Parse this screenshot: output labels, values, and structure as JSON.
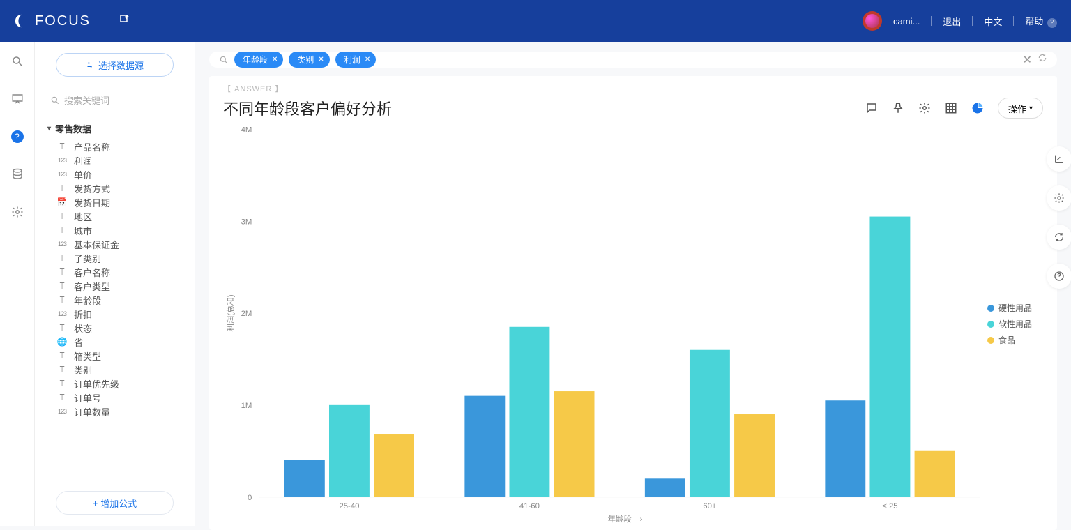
{
  "header": {
    "brand": "FOCUS",
    "user": "cami...",
    "logout": "退出",
    "lang": "中文",
    "help": "帮助"
  },
  "sidebar": {
    "select_datasource": "选择数据源",
    "search_placeholder": "搜索关键词",
    "group_name": "零售数据",
    "fields": [
      {
        "icon": "T",
        "label": "产品名称"
      },
      {
        "icon": "123",
        "label": "利润"
      },
      {
        "icon": "123",
        "label": "单价"
      },
      {
        "icon": "T",
        "label": "发货方式"
      },
      {
        "icon": "cal",
        "label": "发货日期"
      },
      {
        "icon": "T",
        "label": "地区"
      },
      {
        "icon": "T",
        "label": "城市"
      },
      {
        "icon": "123",
        "label": "基本保证金"
      },
      {
        "icon": "T",
        "label": "子类别"
      },
      {
        "icon": "T",
        "label": "客户名称"
      },
      {
        "icon": "T",
        "label": "客户类型"
      },
      {
        "icon": "T",
        "label": "年龄段"
      },
      {
        "icon": "123",
        "label": "折扣"
      },
      {
        "icon": "T",
        "label": "状态"
      },
      {
        "icon": "globe",
        "label": "省"
      },
      {
        "icon": "T",
        "label": "箱类型"
      },
      {
        "icon": "T",
        "label": "类别"
      },
      {
        "icon": "T",
        "label": "订单优先级"
      },
      {
        "icon": "T",
        "label": "订单号"
      },
      {
        "icon": "123",
        "label": "订单数量"
      }
    ],
    "add_formula": "增加公式"
  },
  "search": {
    "pills": [
      "年龄段",
      "类别",
      "利润"
    ]
  },
  "card": {
    "answer_label": "【 ANSWER 】",
    "title": "不同年龄段客户偏好分析",
    "operation": "操作"
  },
  "legend": {
    "series": [
      {
        "label": "硬性用品",
        "color": "#3a97db"
      },
      {
        "label": "软性用品",
        "color": "#49d4d8"
      },
      {
        "label": "食品",
        "color": "#f6c948"
      }
    ]
  },
  "chart_data": {
    "type": "bar",
    "title": "不同年龄段客户偏好分析",
    "xlabel": "年龄段",
    "ylabel": "利润(总和)",
    "ylim": [
      0,
      4000000
    ],
    "yticks": [
      0,
      1000000,
      2000000,
      3000000,
      4000000
    ],
    "ytick_labels": [
      "0",
      "1M",
      "2M",
      "3M",
      "4M"
    ],
    "categories": [
      "25-40",
      "41-60",
      "60+",
      "< 25"
    ],
    "series": [
      {
        "name": "硬性用品",
        "color": "#3a97db",
        "values": [
          400000,
          1100000,
          200000,
          1050000
        ]
      },
      {
        "name": "软性用品",
        "color": "#49d4d8",
        "values": [
          1000000,
          1850000,
          1600000,
          3050000
        ]
      },
      {
        "name": "食品",
        "color": "#f6c948",
        "values": [
          680000,
          1150000,
          900000,
          500000
        ]
      }
    ]
  }
}
